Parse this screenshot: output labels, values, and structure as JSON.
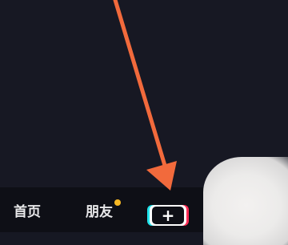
{
  "tab_bar": {
    "home_label": "首页",
    "friends_label": "朋友",
    "friends_badge": true,
    "create_label": "+"
  },
  "colors": {
    "background": "#161823",
    "tab_bar_background": "#0e0f16",
    "badge": "#f6b824",
    "arrow": "#f26a3c",
    "create_cyan": "#21e4ec",
    "create_red": "#fe2c55"
  },
  "annotation": {
    "arrow_icon": "pointing-arrow",
    "points_to": "create-button"
  }
}
